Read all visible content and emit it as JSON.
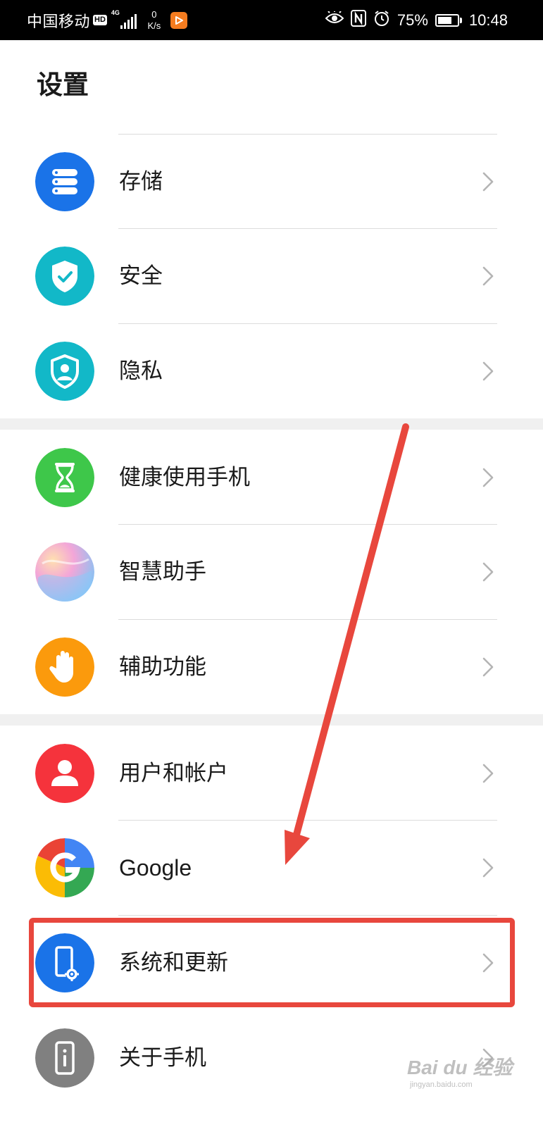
{
  "status_bar": {
    "carrier": "中国移动",
    "hd_badge": "HD",
    "network_type": "4G",
    "net_speed_value": "0",
    "net_speed_unit": "K/s",
    "battery_percent": "75%",
    "battery_level": 0.75,
    "time": "10:48",
    "icons": [
      "eye-comfort-icon",
      "nfc-icon",
      "alarm-icon",
      "battery-icon"
    ]
  },
  "page": {
    "title": "设置"
  },
  "settings": {
    "items": [
      {
        "label": "存储",
        "icon": "storage-icon",
        "color": "#1a73e8"
      },
      {
        "label": "安全",
        "icon": "security-shield-icon",
        "color": "#12b8c8"
      },
      {
        "label": "隐私",
        "icon": "privacy-icon",
        "color": "#12b8c8"
      },
      {
        "label": "健康使用手机",
        "icon": "hourglass-icon",
        "color": "#3ec74a"
      },
      {
        "label": "智慧助手",
        "icon": "smart-assistant-icon",
        "color": "#c7a6f0"
      },
      {
        "label": "辅助功能",
        "icon": "hand-icon",
        "color": "#fb9a0c"
      },
      {
        "label": "用户和帐户",
        "icon": "user-icon",
        "color": "#f5333c"
      },
      {
        "label": "Google",
        "icon": "google-icon",
        "color": "#4285f4"
      },
      {
        "label": "系统和更新",
        "icon": "system-update-icon",
        "color": "#1a73e8"
      },
      {
        "label": "关于手机",
        "icon": "phone-info-icon",
        "color": "#808080"
      }
    ]
  },
  "annotation": {
    "highlight_color": "#e8473d",
    "highlighted_item": "系统和更新"
  },
  "watermark": {
    "brand": "Bai du 经验",
    "url": "jingyan.baidu.com"
  }
}
